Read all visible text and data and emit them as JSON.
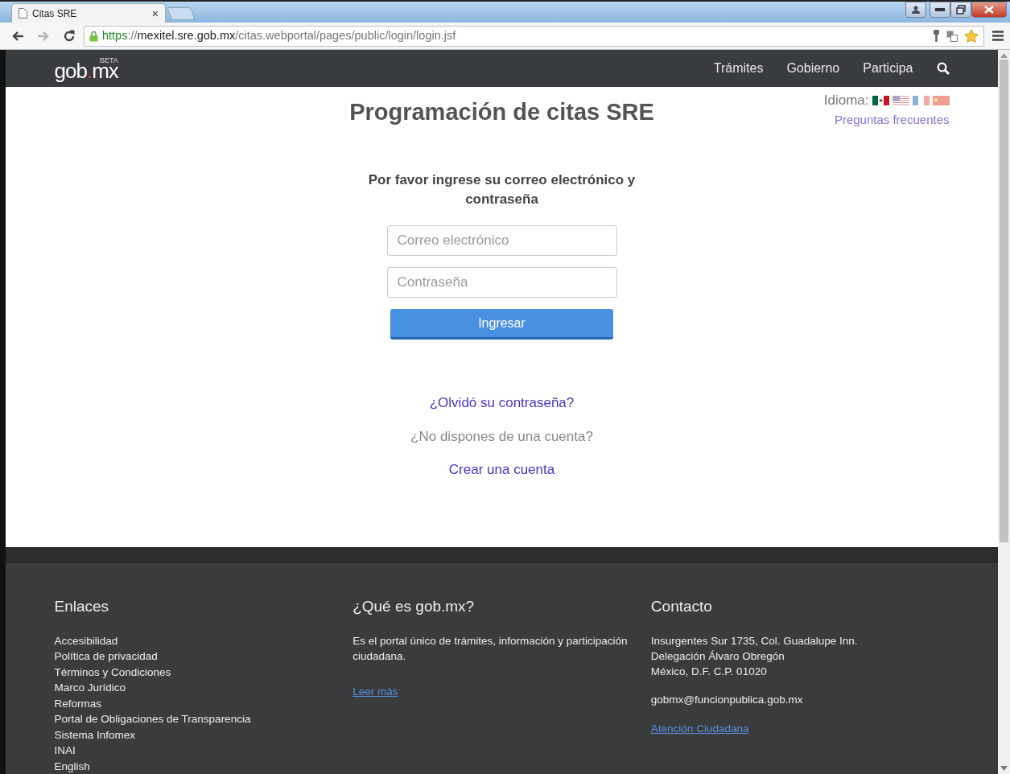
{
  "browser": {
    "tab": {
      "title": "Citas SRE",
      "close": "×"
    },
    "nav_buttons": [
      {
        "kind": "back",
        "disabled": false
      },
      {
        "kind": "forward",
        "disabled": true
      },
      {
        "kind": "reload",
        "disabled": false
      }
    ],
    "url": {
      "scheme": "https",
      "separator": "://",
      "host": "mexitel.sre.gob.mx",
      "path": "/citas.webportal/pages/public/login/login.jsf"
    }
  },
  "header": {
    "logo": {
      "left": "gob",
      "dot": ".",
      "right": "mx",
      "badge": "BETA"
    },
    "nav": [
      "Trámites",
      "Gobierno",
      "Participa"
    ]
  },
  "language": {
    "label": "Idioma:",
    "flags": [
      {
        "kind": "mexico",
        "dimmed": false
      },
      {
        "kind": "usa",
        "dimmed": true
      },
      {
        "kind": "france",
        "dimmed": true
      },
      {
        "kind": "china",
        "dimmed": true
      }
    ]
  },
  "faq_link": "Preguntas frecuentes",
  "login": {
    "title": "Programación de citas SRE",
    "instruction": "Por favor ingrese su correo electrónico y contraseña",
    "fields": [
      {
        "placeholder": "Correo electrónico"
      },
      {
        "placeholder": "Contraseña"
      }
    ],
    "submit": "Ingresar",
    "forgot_link": "¿Olvidó su contraseña?",
    "no_account": "¿No dispones de una cuenta?",
    "create_link": "Crear una cuenta"
  },
  "footer": {
    "links_column": {
      "heading": "Enlaces",
      "links": [
        "Accesibilidad",
        "Política de privacidad",
        "Términos y Condiciones",
        "Marco Jurídico",
        "Reformas",
        "Portal de Obligaciones de Transparencia",
        "Sistema Infomex",
        "INAI",
        "English"
      ]
    },
    "about_column": {
      "heading": "¿Qué es gob.mx?",
      "text": "Es el portal único de trámites, información y participación ciudadana.",
      "link": "Leer más"
    },
    "contact_column": {
      "heading": "Contacto",
      "address": [
        "Insurgentes Sur 1735, Col. Guadalupe Inn.",
        "Delegación Álvaro Obregón",
        "México, D.F. C.P. 01020"
      ],
      "email": "gobmx@funcionpublica.gob.mx",
      "link": "Atención Ciudadana"
    }
  }
}
